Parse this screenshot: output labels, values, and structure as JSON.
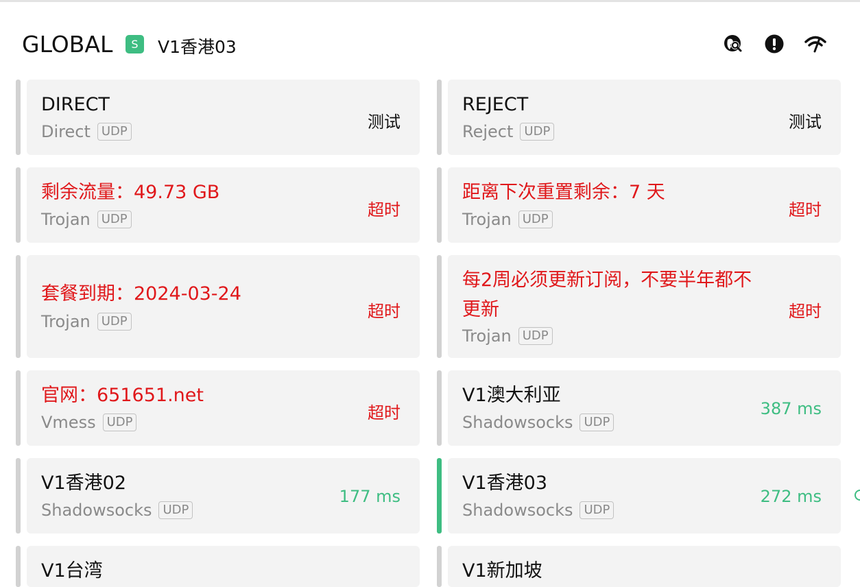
{
  "header": {
    "group_name": "GLOBAL",
    "group_type_badge": "S",
    "selected_proxy": "V1香港03",
    "icons": [
      "globe-search-icon",
      "alert-circle-icon",
      "wifi-speed-icon"
    ]
  },
  "colors": {
    "accent_green": "#3ebd82",
    "error_red": "#e0181b",
    "card_bg": "#f3f3f3",
    "bar_inactive": "#d2d2d2"
  },
  "proxies": [
    {
      "name": "DIRECT",
      "type": "Direct",
      "udp": "UDP",
      "delay": "测试",
      "name_color": "normal",
      "delay_status": "test",
      "selected": false
    },
    {
      "name": "REJECT",
      "type": "Reject",
      "udp": "UDP",
      "delay": "测试",
      "name_color": "normal",
      "delay_status": "test",
      "selected": false
    },
    {
      "name": "剩余流量：49.73 GB",
      "type": "Trojan",
      "udp": "UDP",
      "delay": "超时",
      "name_color": "red",
      "delay_status": "timeout",
      "selected": false
    },
    {
      "name": "距离下次重置剩余：7 天",
      "type": "Trojan",
      "udp": "UDP",
      "delay": "超时",
      "name_color": "red",
      "delay_status": "timeout",
      "selected": false
    },
    {
      "name": "套餐到期：2024-03-24",
      "type": "Trojan",
      "udp": "UDP",
      "delay": "超时",
      "name_color": "red",
      "delay_status": "timeout",
      "selected": false
    },
    {
      "name": "每2周必须更新订阅，不要半年都不更新",
      "type": "Trojan",
      "udp": "UDP",
      "delay": "超时",
      "name_color": "red",
      "delay_status": "timeout",
      "selected": false
    },
    {
      "name": "官网：651651.net",
      "type": "Vmess",
      "udp": "UDP",
      "delay": "超时",
      "name_color": "red",
      "delay_status": "timeout",
      "selected": false
    },
    {
      "name": "V1澳大利亚",
      "type": "Shadowsocks",
      "udp": "UDP",
      "delay": "387 ms",
      "name_color": "normal",
      "delay_status": "ok",
      "selected": false
    },
    {
      "name": "V1香港02",
      "type": "Shadowsocks",
      "udp": "UDP",
      "delay": "177 ms",
      "name_color": "normal",
      "delay_status": "ok",
      "selected": false
    },
    {
      "name": "V1香港03",
      "type": "Shadowsocks",
      "udp": "UDP",
      "delay": "272 ms",
      "name_color": "normal",
      "delay_status": "ok",
      "selected": true
    },
    {
      "name": "V1台湾",
      "type": "",
      "udp": "",
      "delay": "",
      "name_color": "normal",
      "delay_status": "ok",
      "selected": false
    },
    {
      "name": "V1新加坡",
      "type": "",
      "udp": "",
      "delay": "",
      "name_color": "normal",
      "delay_status": "ok",
      "selected": false
    }
  ]
}
